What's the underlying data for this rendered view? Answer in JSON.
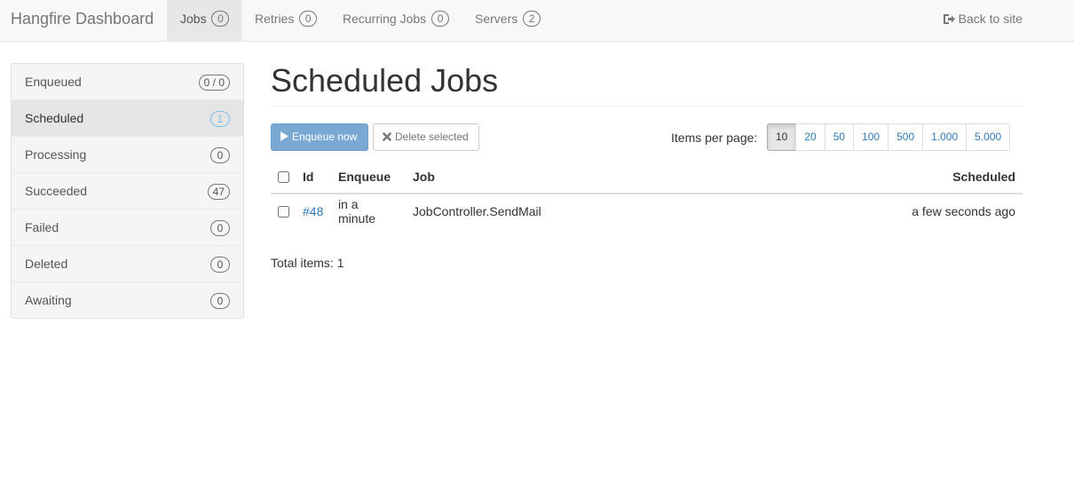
{
  "navbar": {
    "brand": "Hangfire Dashboard",
    "items": [
      {
        "label": "Jobs",
        "count": "0",
        "active": true
      },
      {
        "label": "Retries",
        "count": "0"
      },
      {
        "label": "Recurring Jobs",
        "count": "0"
      },
      {
        "label": "Servers",
        "count": "2"
      }
    ],
    "back_link": {
      "label": "Back to site",
      "icon": "sign-out-icon"
    }
  },
  "sidebar": {
    "items": [
      {
        "label": "Enqueued",
        "count": "0 / 0"
      },
      {
        "label": "Scheduled",
        "count": "1",
        "active": true
      },
      {
        "label": "Processing",
        "count": "0"
      },
      {
        "label": "Succeeded",
        "count": "47"
      },
      {
        "label": "Failed",
        "count": "0"
      },
      {
        "label": "Deleted",
        "count": "0"
      },
      {
        "label": "Awaiting",
        "count": "0"
      }
    ]
  },
  "main": {
    "title": "Scheduled Jobs",
    "enqueue_button": {
      "label": "Enqueue now",
      "icon": "play-icon"
    },
    "delete_button": {
      "label": "Delete selected",
      "icon": "remove-icon"
    },
    "items_per_page_label": "Items per page:",
    "page_sizes": [
      "10",
      "20",
      "50",
      "100",
      "500",
      "1.000",
      "5.000"
    ],
    "selected_page_size": "10",
    "table": {
      "headers": {
        "id": "Id",
        "enqueue": "Enqueue",
        "job": "Job",
        "scheduled": "Scheduled"
      },
      "rows": [
        {
          "id": "#48",
          "enqueue": "in a minute",
          "job": "JobController.SendMail",
          "scheduled": "a few seconds ago"
        }
      ]
    },
    "total_items": "Total items: 1"
  },
  "colors": {
    "primary_button": "#79a8d2",
    "link": "#337ab7",
    "active_badge": "#7ebfe7"
  }
}
